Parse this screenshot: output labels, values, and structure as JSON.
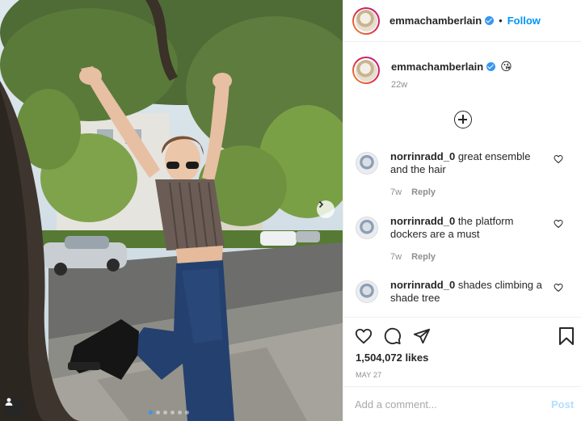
{
  "post": {
    "author": {
      "username": "emmachamberlain",
      "verified": true,
      "avatar_icon": "avatar-photo"
    },
    "follow_label": "Follow",
    "separator": "•",
    "caption": {
      "emoji": "😘",
      "time": "22w"
    },
    "media": {
      "slide_count": 6,
      "active_slide": 1,
      "next_icon": "chevron-right-icon",
      "tag_icon": "user-tag-icon"
    },
    "comments": [
      {
        "username": "norrinradd_0",
        "text": "great ensemble and the hair",
        "time": "7w",
        "reply_label": "Reply"
      },
      {
        "username": "norrinradd_0",
        "text": "the platform dockers are a must",
        "time": "7w",
        "reply_label": "Reply"
      },
      {
        "username": "norrinradd_0",
        "text": "shades climbing a shade tree",
        "time": "",
        "reply_label": ""
      }
    ],
    "load_more_icon": "plus-circle-icon",
    "likes": "1,504,072 likes",
    "date": "MAY 27",
    "add_comment": {
      "placeholder": "Add a comment...",
      "post_label": "Post"
    },
    "colors": {
      "link_blue": "#0095f6",
      "verified_blue": "#3897f0",
      "post_disabled": "#b2dffc",
      "muted_text": "#8e8e8e"
    }
  }
}
